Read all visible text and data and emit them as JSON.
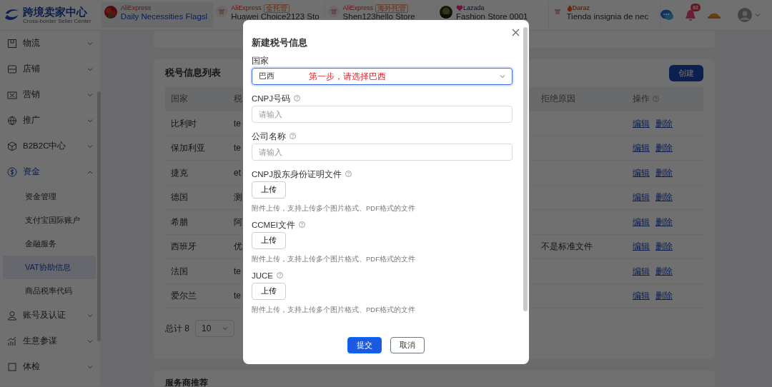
{
  "header": {
    "logo_title": "跨境卖家中心",
    "logo_subtitle": "Cross-border Seller Center",
    "store_tabs": [
      {
        "platform": "AliExpress",
        "kind": "aliexpress",
        "name": "Daily Necessities Flagsl",
        "selected": true
      },
      {
        "platform": "AliExpress",
        "kind": "aliexpress",
        "badge": "全托管",
        "name": "Huawei Choice2123 Sto",
        "selected": false
      },
      {
        "platform": "AliExpress",
        "kind": "aliexpress",
        "badge": "海外托管",
        "name": "Shen123hello Store",
        "selected": false
      },
      {
        "platform": "Lazada",
        "kind": "lazada",
        "name": "Fashion Store 0001",
        "selected": false
      },
      {
        "platform": "Daraz",
        "kind": "daraz",
        "name": "Tienda insignia de nec",
        "selected": false
      }
    ],
    "notification_count": "92"
  },
  "sidebar": {
    "items": [
      {
        "label": "物流",
        "expanded": false,
        "selected": false
      },
      {
        "label": "店铺",
        "expanded": false,
        "selected": false
      },
      {
        "label": "营销",
        "expanded": false,
        "selected": false
      },
      {
        "label": "推广",
        "expanded": false,
        "selected": false
      },
      {
        "label": "B2B2C中心",
        "expanded": false,
        "selected": false
      },
      {
        "label": "资金",
        "expanded": true,
        "selected": true,
        "children": [
          {
            "label": "资金管理",
            "selected": false
          },
          {
            "label": "支付宝国际账户",
            "selected": false
          },
          {
            "label": "金融服务",
            "selected": false
          },
          {
            "label": "VAT协助信息",
            "selected": true
          },
          {
            "label": "商品税率代码",
            "selected": false
          }
        ]
      },
      {
        "label": "账号及认证",
        "expanded": false,
        "selected": false
      },
      {
        "label": "生意参谋",
        "expanded": false,
        "selected": false
      },
      {
        "label": "体检",
        "expanded": false,
        "selected": false
      }
    ]
  },
  "tax_list": {
    "title": "税号信息列表",
    "create_button": "创建",
    "columns": [
      {
        "label": "国家",
        "help": false
      },
      {
        "label": "税",
        "help": false
      },
      {
        "label": "拒绝原因",
        "help": false
      },
      {
        "label": "操作",
        "help": true
      }
    ],
    "rows": [
      {
        "country": "比利时",
        "column_2": "te",
        "actions": [
          "编辑",
          "删除"
        ]
      },
      {
        "country": "保加利亚",
        "column_2": "te",
        "actions": [
          "编辑",
          "删除"
        ]
      },
      {
        "country": "捷克",
        "column_2": "et",
        "actions": [
          "编辑",
          "删除"
        ]
      },
      {
        "country": "德国",
        "column_2": "测",
        "actions": [
          "编辑",
          "删除"
        ]
      },
      {
        "country": "希腊",
        "column_2": "阿",
        "actions": [
          "编辑",
          "删除"
        ]
      },
      {
        "country": "西班牙",
        "column_2": "优",
        "reject_reason": "不是标准文件",
        "actions": [
          "编辑",
          "删除"
        ]
      },
      {
        "country": "法国",
        "column_2": "te",
        "actions": [
          "编辑",
          "删除"
        ]
      },
      {
        "country": "爱尔兰",
        "column_2": "te",
        "actions": [
          "编辑",
          "删除"
        ]
      }
    ],
    "pagination": {
      "total": "总计 8",
      "page_size": "10"
    }
  },
  "recommend_title": "服务商推荐",
  "modal": {
    "title": "新建税号信息",
    "fields": [
      {
        "kind": "select",
        "label": "国家",
        "help": false,
        "value": "巴西",
        "note": "第一步，请选择巴西",
        "focused": true
      },
      {
        "kind": "input",
        "label": "CNPJ号码",
        "help": true,
        "placeholder": "请输入"
      },
      {
        "kind": "input",
        "label": "公司名称",
        "help": true,
        "placeholder": "请输入"
      },
      {
        "kind": "upload",
        "label": "CNPJ股东身份证明文件",
        "help": true,
        "button": "上传",
        "hint": "附件上传，支持上传多个图片格式、PDF格式的文件"
      },
      {
        "kind": "upload",
        "label": "CCMEI文件",
        "help": true,
        "button": "上传",
        "hint": "附件上传，支持上传多个图片格式、PDF格式的文件"
      },
      {
        "kind": "upload",
        "label": "JUCE",
        "help": true,
        "button": "上传",
        "hint": "附件上传，支持上传多个图片格式、PDF格式的文件"
      }
    ],
    "buttons": [
      {
        "label": "提交",
        "primary": true
      },
      {
        "label": "取消",
        "primary": false
      }
    ]
  }
}
